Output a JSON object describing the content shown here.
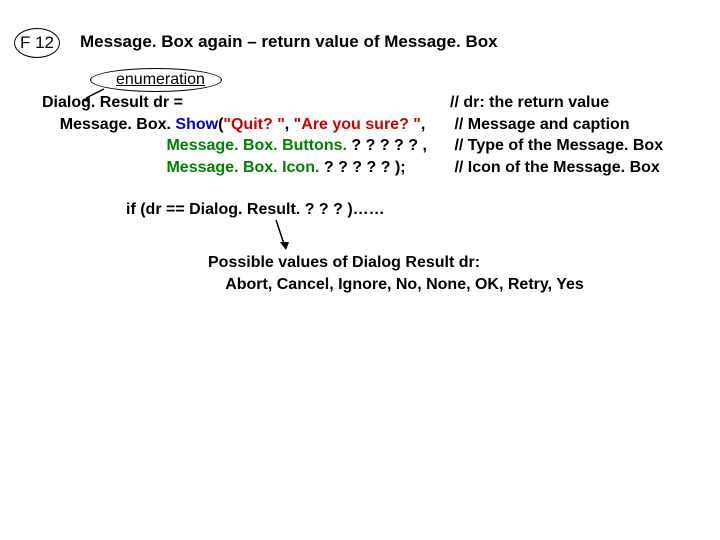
{
  "badge": "F 12",
  "title": "Message. Box again – return value of Message. Box",
  "enum_label": "enumeration",
  "code": {
    "l1a": "Dialog. Result",
    "l1b": " dr =",
    "l2a": "    Message. Box. ",
    "l2b": "Show",
    "l2c": "(",
    "l2d": "\"Quit? \"",
    "l2e": ", ",
    "l2f": "\"Are you sure? \"",
    "l2g": ",",
    "l3a": "                            ",
    "l3b": "Message. Box. Buttons. ",
    "l3c": "? ? ? ? ? ,",
    "l4a": "                            ",
    "l4b": "Message. Box. Icon. ",
    "l4c": "? ? ? ? ? );"
  },
  "comments": {
    "c1": "// dr: the return value",
    "c2": " // Message and caption",
    "c3": " // Type of the Message. Box",
    "c4": " // Icon of the Message. Box"
  },
  "if_line": "if (dr == Dialog. Result. ? ? ? )……",
  "possible": {
    "p1": "Possible values of Dialog Result dr:",
    "p2": "    Abort, Cancel, Ignore, No, None, OK, Retry, Yes"
  }
}
